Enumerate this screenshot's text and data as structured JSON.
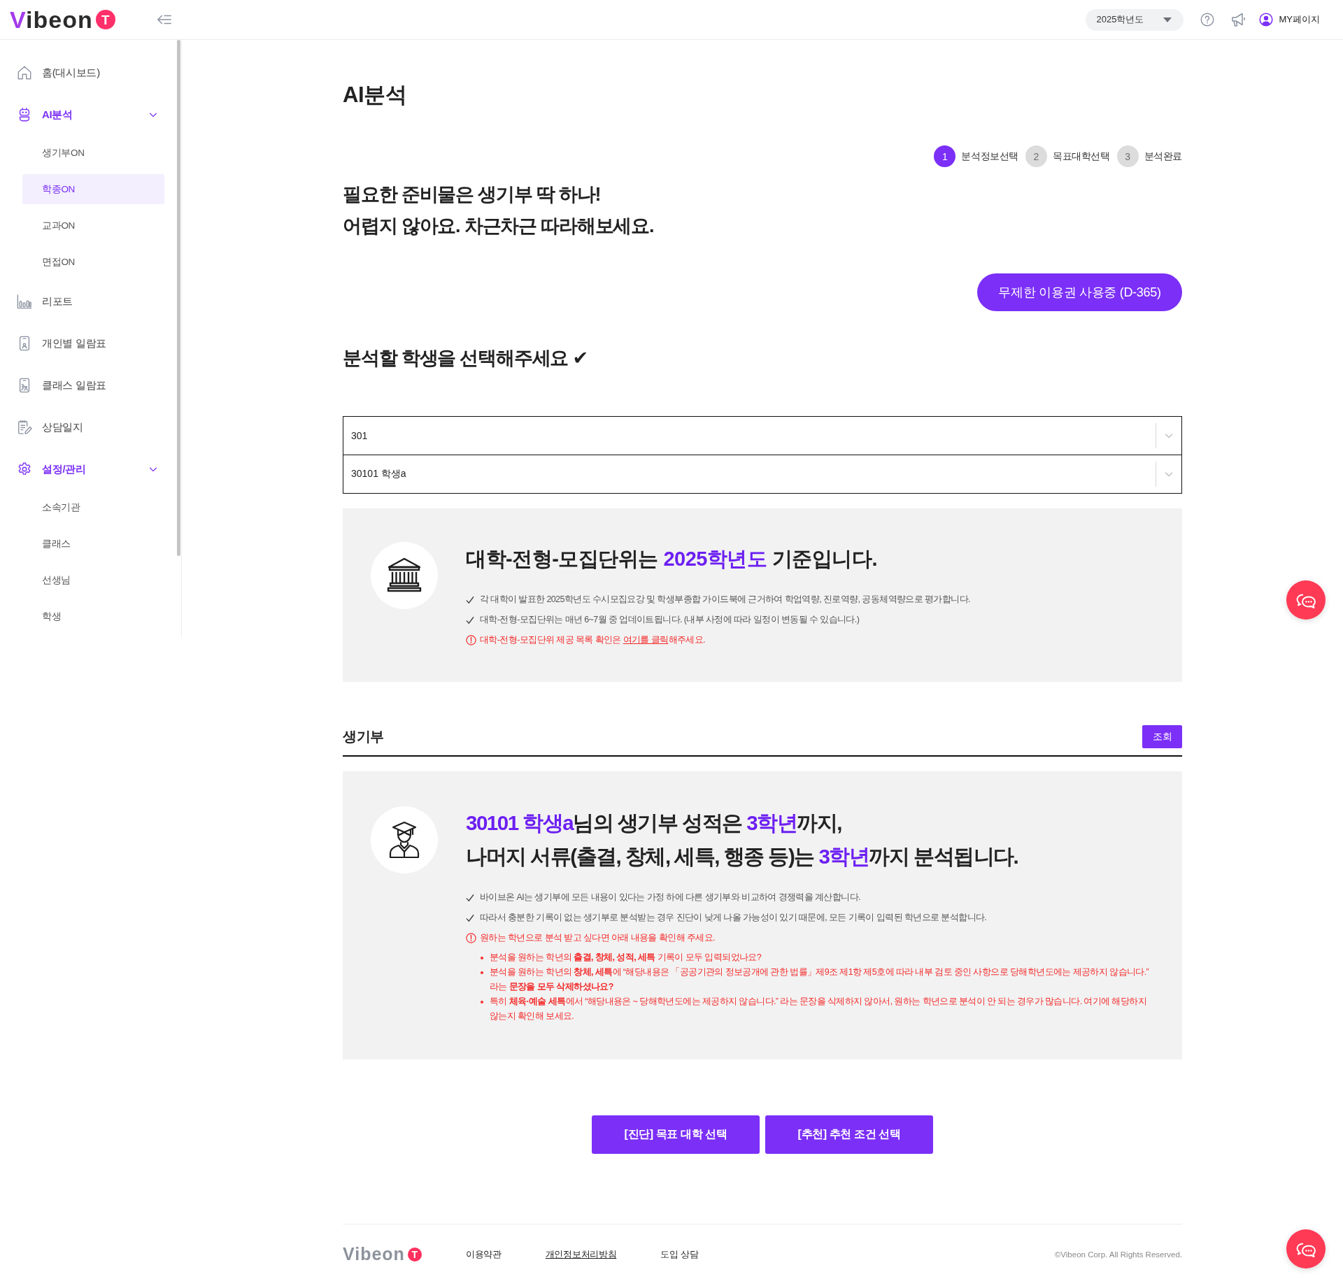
{
  "header": {
    "logo": {
      "wordmark": "Vibeon",
      "badge": "T"
    },
    "year_select": {
      "value": "2025학년도"
    },
    "mypage_link": "MY페이지"
  },
  "sidebar": {
    "items": [
      {
        "label": "홈(대시보드)",
        "selected": false,
        "expanded": false
      },
      {
        "label": "AI분석",
        "selected": false,
        "expanded": true,
        "children": [
          {
            "label": "생기부ON",
            "selected": false
          },
          {
            "label": "학종ON",
            "selected": true
          },
          {
            "label": "교과ON",
            "selected": false
          },
          {
            "label": "면접ON",
            "selected": false
          }
        ]
      },
      {
        "label": "리포트",
        "selected": false,
        "expanded": false
      },
      {
        "label": "개인별 일람표",
        "selected": false,
        "expanded": false
      },
      {
        "label": "클래스 일람표",
        "selected": false,
        "expanded": false
      },
      {
        "label": "상담일지",
        "selected": false,
        "expanded": false
      },
      {
        "label": "설정/관리",
        "selected": false,
        "expanded": true,
        "children": [
          {
            "label": "소속기관",
            "selected": false
          },
          {
            "label": "클래스",
            "selected": false
          },
          {
            "label": "선생님",
            "selected": false
          },
          {
            "label": "학생",
            "selected": false
          }
        ]
      }
    ]
  },
  "page_title": "AI분석",
  "steps": [
    {
      "number": "1",
      "label": "분석정보선택",
      "selected": true
    },
    {
      "number": "2",
      "label": "목표대학선택",
      "selected": false
    },
    {
      "number": "3",
      "label": "분석완료",
      "selected": false
    }
  ],
  "intro": {
    "lines": [
      "필요한 준비물은 생기부 딱 하나!",
      "어렵지 않아요. 차근차근 따라해보세요."
    ]
  },
  "pass_button": "무제한 이용권 사용중 (D-365)",
  "student_select": {
    "heading": "분석할 학생을 선택해주세요 ✔",
    "dropdowns": [
      {
        "value": "301"
      },
      {
        "value": "30101 학생a"
      }
    ]
  },
  "admission_notice": {
    "title_lines": [
      "대학-전형-모집단위는 **2025학년도** 기준입니다."
    ],
    "notes": [
      {
        "kind": "check",
        "text": "각 대학이 발표한 2025학년도 수시모집요강 및 학생부종합 가이드북에 근거하여 학업역량, 진로역량, 공동체역량으로 평가합니다."
      },
      {
        "kind": "check",
        "text": "대학-전형-모집단위는 매년 6~7월 중 업데이트됩니다. (내부 사정에 따라 일정이 변동될 수 있습니다.)"
      },
      {
        "kind": "warning",
        "text": "대학-전형-모집단위 제공 목록 확인은 ",
        "link": "여기를 클릭",
        "text_after": "해주세요."
      }
    ]
  },
  "record_section": {
    "title": "생기부",
    "button": "조회",
    "notice": {
      "title_lines": [
        "**30101 학생a**님의 생기부 성적은 **3학년**까지,",
        "나머지 서류(출결, 창체, 세특, 행종 등)는 **3학년**까지 분석됩니다."
      ],
      "notes": [
        {
          "kind": "check",
          "text": "바이브온 AI는 생기부에 모든 내용이 있다는 가정 하에 다른 생기부와 비교하여 경쟁력을 계산합니다."
        },
        {
          "kind": "check",
          "text": "따라서 충분한 기록이 없는 생기부로 분석받는 경우 진단이 낮게 나올 가능성이 있기 때문에, 모든 기록이 입력된 학년으로 분석합니다."
        },
        {
          "kind": "warning",
          "text": "원하는 학년으로 분석 받고 싶다면 아래 내용을 확인해 주세요.",
          "details": [
            "분석을 원하는 학년의 **출결, 창체, 성적, 세특** 기록이 모두 입력되었나요?",
            "분석을 원하는 학년의 **창체, 세특**에 “해당내용은 「공공기관의 정보공개에 관한 법률」제9조 제1항 제5호에 따라 내부 검토 중인 사항으로 당해학년도에는 제공하지 않습니다.” 라는 **문장을 모두 삭제하셨나요?**",
            "특히 **체육·예술 세특**에서 “해당내용은 ~ 당해학년도에는 제공하지 않습니다.” 라는 문장을 삭제하지 않아서, 원하는 학년으로 분석이 안 되는 경우가 많습니다. 여기에 해당하지 않는지 확인해 보세요."
          ]
        }
      ]
    }
  },
  "action_buttons": [
    "[진단] 목표 대학 선택",
    "[추천] 추천 조건 선택"
  ],
  "footer": {
    "logo": {
      "wordmark": "Vibeon",
      "badge": "T"
    },
    "links": [
      {
        "label": "이용약관",
        "underline": false
      },
      {
        "label": "개인정보처리방침",
        "underline": true
      },
      {
        "label": "도입 상담",
        "underline": false
      }
    ],
    "copyright": "©Vibeon Corp. All Rights Reserved."
  }
}
